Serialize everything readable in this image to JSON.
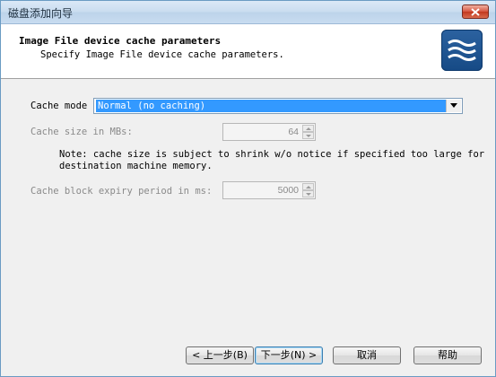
{
  "window": {
    "title": "磁盘添加向导"
  },
  "header": {
    "title": "Image File device cache parameters",
    "subtitle": "Specify Image File device cache parameters.",
    "logo_icon": "wave-logo-icon"
  },
  "form": {
    "cache_mode": {
      "label": "Cache mode",
      "value": "Normal (no caching)"
    },
    "cache_size": {
      "label": "Cache size in MBs:",
      "value": "64"
    },
    "note_line1": "Note: cache size is subject to shrink w/o notice if specified too large for",
    "note_line2": "destination machine memory.",
    "cache_expiry": {
      "label": "Cache block expiry period in ms:",
      "value": "5000"
    }
  },
  "buttons": {
    "back_label": "< 上一步(B)",
    "next_label": "下一步(N) >",
    "cancel_label": "取消",
    "help_label": "帮助"
  },
  "colors": {
    "selection": "#3399ff",
    "logo": "#1a4f8c",
    "close": "#c94a34"
  }
}
